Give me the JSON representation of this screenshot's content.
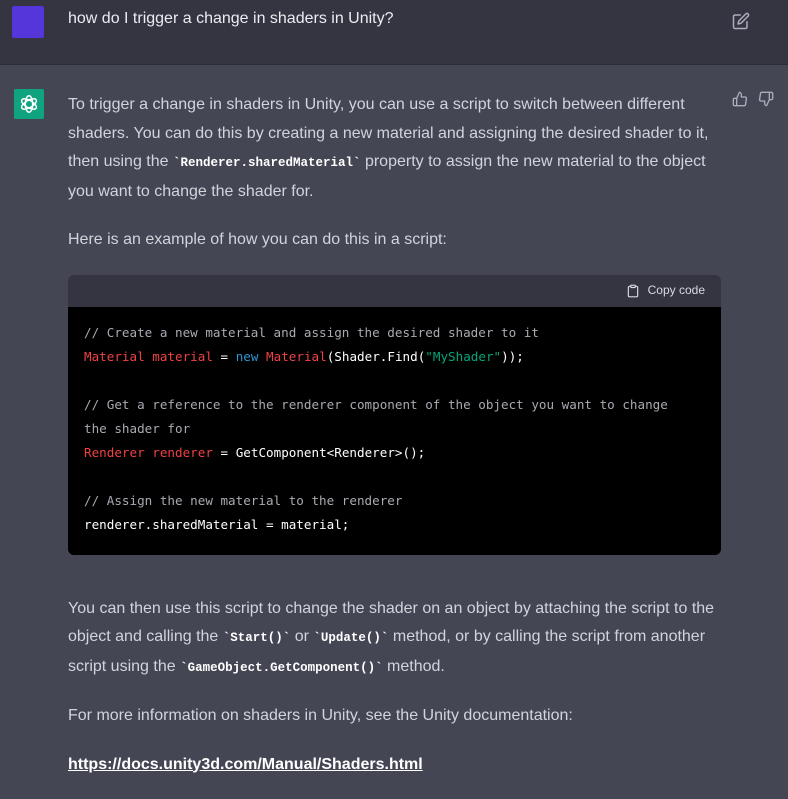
{
  "user_message": {
    "text": "how do I trigger a change in shaders in Unity?"
  },
  "assistant": {
    "para1": {
      "a": "To trigger a change in shaders in Unity, you can use a script to switch between different shaders. You can do this by creating a new material and assigning the desired shader to it, then using the ",
      "code": "`Renderer.sharedMaterial`",
      "b": " property to assign the new material to the object you want to change the shader for."
    },
    "para2": "Here is an example of how you can do this in a script:",
    "code_block": {
      "copy_label": "Copy code",
      "lines": {
        "l1": "// Create a new material and assign the desired shader to it",
        "l2_t1": "Material",
        "l2_t2": "material",
        "l2_t3": "new",
        "l2_t4": "Material",
        "l2_t5": "(Shader.Find(",
        "l2_t6": "\"MyShader\"",
        "l2_t7": "));",
        "l3": "// Get a reference to the renderer component of the object you want to change",
        "l4": "the shader for",
        "l5_t1": "Renderer",
        "l5_t2": "renderer",
        "l5_t3": "= GetComponent<Renderer>();",
        "l6": "// Assign the new material to the renderer",
        "l7": "renderer.sharedMaterial = material;"
      }
    },
    "para3": {
      "a": "You can then use this script to change the shader on an object by attaching the script to the object and calling the ",
      "code1": "`Start()`",
      "b": " or ",
      "code2": "`Update()`",
      "c": " method, or by calling the script from another script using the ",
      "code3": "`GameObject.GetComponent()`",
      "d": " method."
    },
    "para4": "For more information on shaders in Unity, see the Unity documentation:",
    "link": "https://docs.unity3d.com/Manual/Shaders.html"
  },
  "colors": {
    "user_bg": "#343541",
    "assistant_bg": "#444654",
    "user_avatar": "#5436da",
    "bot_avatar": "#10a37f",
    "code_bg": "#000000"
  },
  "icons": [
    "edit-icon",
    "openai-logo-icon",
    "thumbs-up-icon",
    "thumbs-down-icon",
    "clipboard-icon"
  ]
}
